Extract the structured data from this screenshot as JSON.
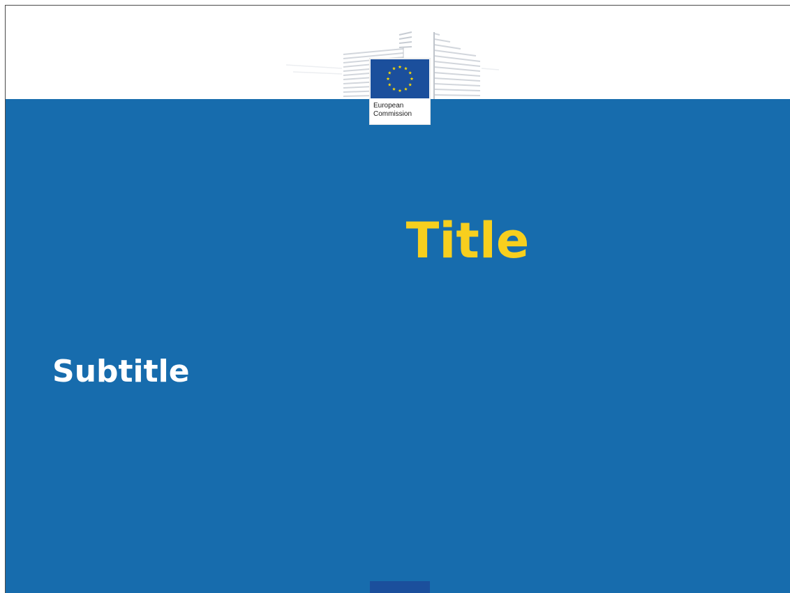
{
  "slide": {
    "title": "Title",
    "subtitle": "Subtitle"
  },
  "logo": {
    "line1": "European",
    "line2": "Commission"
  },
  "colors": {
    "background_blue": "#176cad",
    "title_yellow": "#f7cf1e",
    "subtitle_white": "#ffffff",
    "eu_flag_blue": "#1b4f9c",
    "eu_star_yellow": "#ffdd00"
  }
}
